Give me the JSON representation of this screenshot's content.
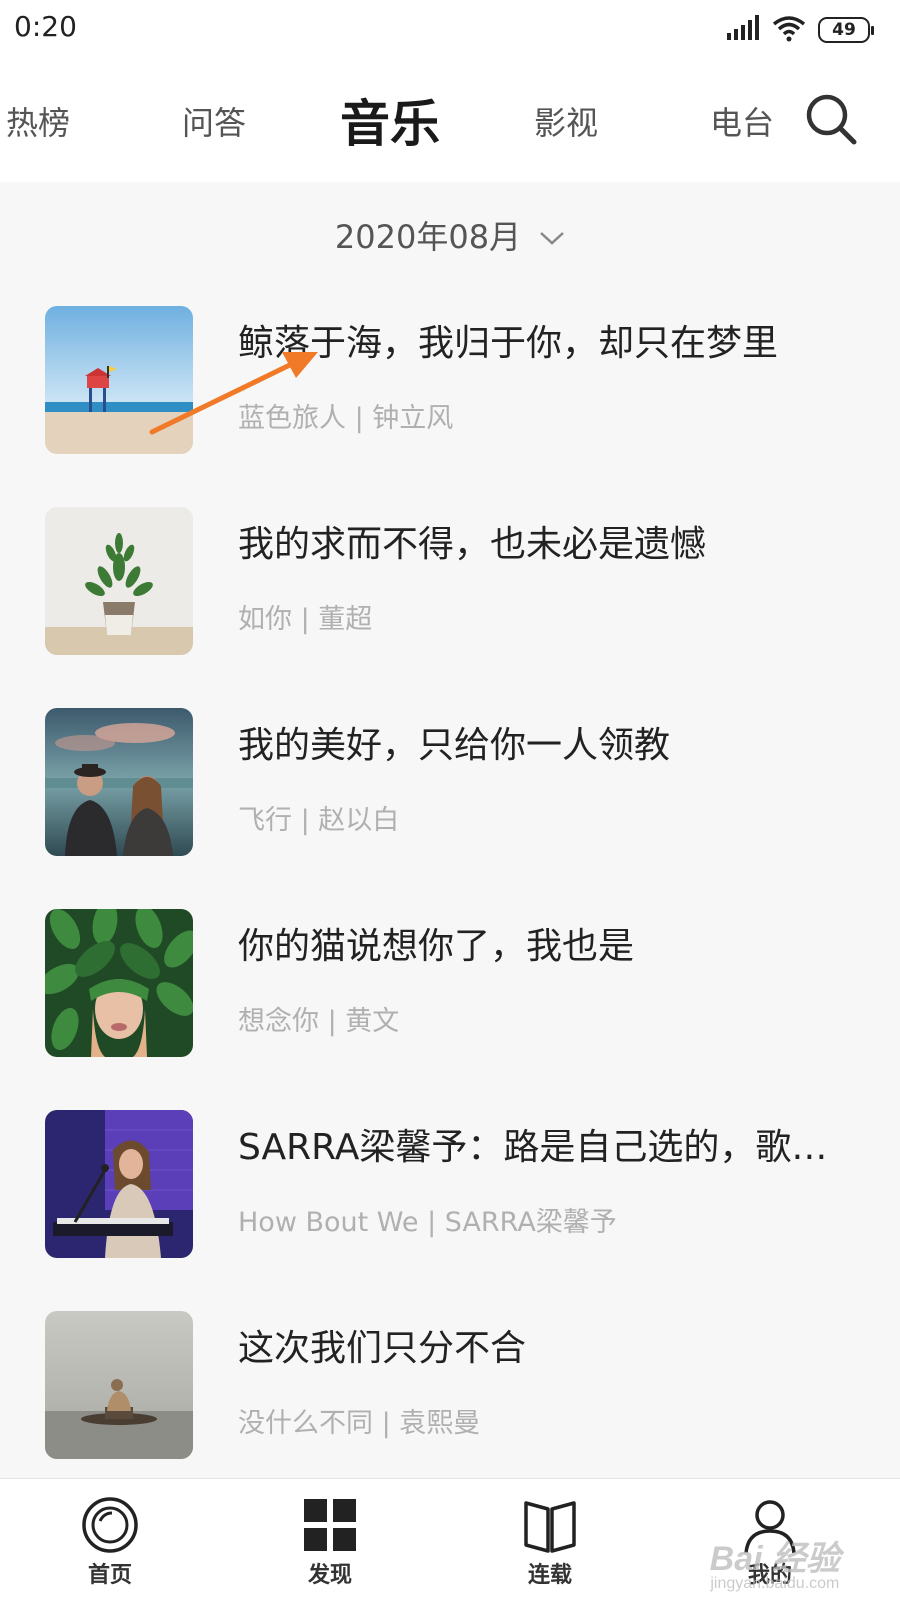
{
  "status_bar": {
    "time": "0:20",
    "battery": "49"
  },
  "top_nav": {
    "tabs": [
      {
        "label": "热榜",
        "active": false
      },
      {
        "label": "问答",
        "active": false
      },
      {
        "label": "音乐",
        "active": true
      },
      {
        "label": "影视",
        "active": false
      },
      {
        "label": "电台",
        "active": false
      }
    ],
    "search_icon": "search-icon"
  },
  "date_selector": {
    "value": "2020年08月",
    "icon": "chevron-down-icon"
  },
  "songs": [
    {
      "title": "鲸落于海，我归于你，却只在梦里",
      "subtitle": "蓝色旅人 | 钟立风"
    },
    {
      "title": "我的求而不得，也未必是遗憾",
      "subtitle": "如你 | 董超"
    },
    {
      "title": "我的美好，只给你一人领教",
      "subtitle": "飞行 | 赵以白"
    },
    {
      "title": "你的猫说想你了，我也是",
      "subtitle": "想念你 | 黄文"
    },
    {
      "title": "SARRA梁馨予：路是自己选的，歌…",
      "subtitle": "How Bout We | SARRA梁馨予"
    },
    {
      "title": "这次我们只分不合",
      "subtitle": "没什么不同 | 袁熙曼"
    }
  ],
  "bottom_nav": {
    "items": [
      {
        "label": "首页",
        "icon": "home-circle-icon"
      },
      {
        "label": "发现",
        "icon": "grid-icon"
      },
      {
        "label": "连载",
        "icon": "book-icon"
      },
      {
        "label": "我的",
        "icon": "user-icon"
      }
    ]
  },
  "watermark": {
    "main": "Bai 经验",
    "sub": "jingyan.baidu.com"
  },
  "colors": {
    "background": "#f7f7f7",
    "text_primary": "#222222",
    "text_secondary": "#b0b0b0",
    "annotation_arrow": "#f07a28"
  }
}
